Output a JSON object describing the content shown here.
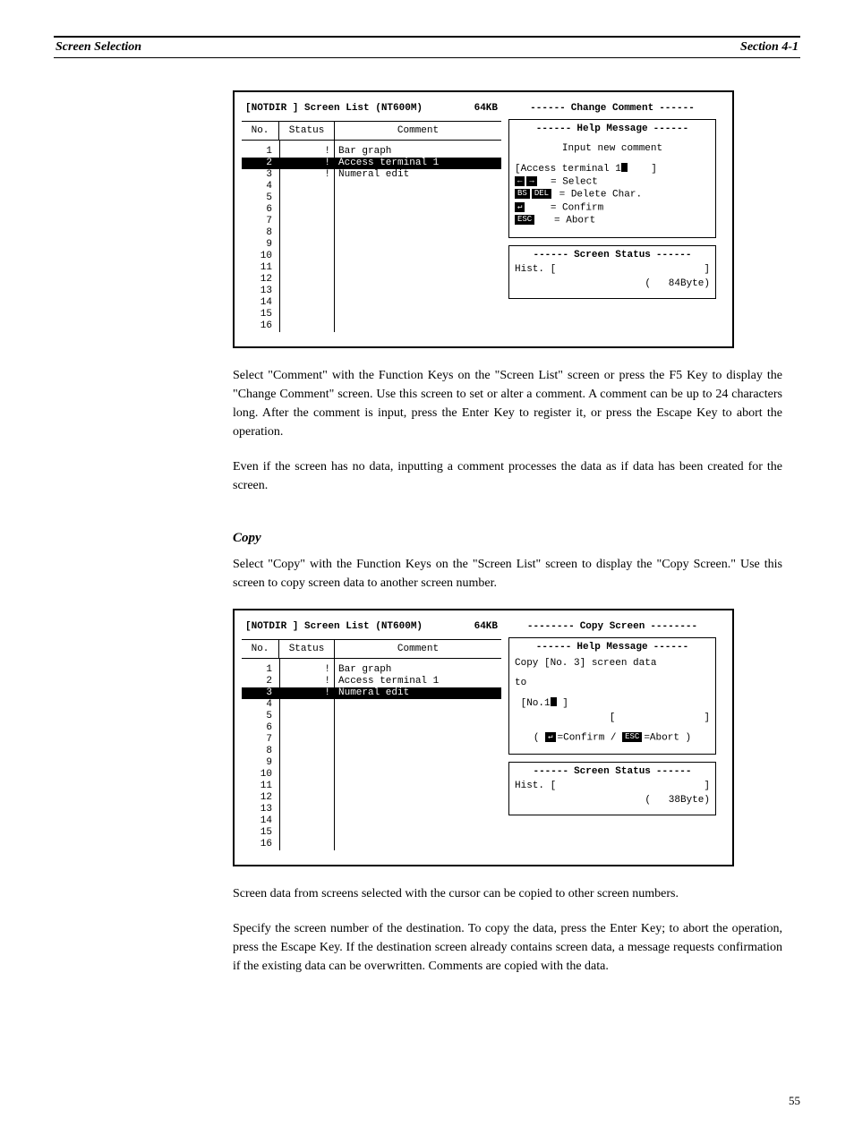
{
  "header": {
    "left": "Screen Selection",
    "right": "Section 4-1"
  },
  "fig1": {
    "title_left": "[NOTDIR  ]  Screen List (NT600M)",
    "title_right": "64KB",
    "cols": {
      "no": "No.",
      "status": "Status",
      "comment": "Comment"
    },
    "rows": [
      {
        "no": "1",
        "status": "!",
        "comment": "Bar graph",
        "sel": false
      },
      {
        "no": "2",
        "status": "!",
        "comment": "Access terminal 1",
        "sel": true
      },
      {
        "no": "3",
        "status": "!",
        "comment": "Numeral edit",
        "sel": false
      },
      {
        "no": "4",
        "status": "",
        "comment": "",
        "sel": false
      },
      {
        "no": "5",
        "status": "",
        "comment": "",
        "sel": false
      },
      {
        "no": "6",
        "status": "",
        "comment": "",
        "sel": false
      },
      {
        "no": "7",
        "status": "",
        "comment": "",
        "sel": false
      },
      {
        "no": "8",
        "status": "",
        "comment": "",
        "sel": false
      },
      {
        "no": "9",
        "status": "",
        "comment": "",
        "sel": false
      },
      {
        "no": "10",
        "status": "",
        "comment": "",
        "sel": false
      },
      {
        "no": "11",
        "status": "",
        "comment": "",
        "sel": false
      },
      {
        "no": "12",
        "status": "",
        "comment": "",
        "sel": false
      },
      {
        "no": "13",
        "status": "",
        "comment": "",
        "sel": false
      },
      {
        "no": "14",
        "status": "",
        "comment": "",
        "sel": false
      },
      {
        "no": "15",
        "status": "",
        "comment": "",
        "sel": false
      },
      {
        "no": "16",
        "status": "",
        "comment": "",
        "sel": false
      }
    ],
    "panel_title": "Change Comment",
    "help_title": "Help Message",
    "help": {
      "l1": "Input new comment",
      "input": "[Access terminal 1",
      "close": "]",
      "k_select": "= Select",
      "k_del": "= Delete Char.",
      "k_conf": "= Confirm",
      "k_abort": "= Abort",
      "keys": {
        "left": "←",
        "right": "→",
        "bs": "BS",
        "del": "DEL",
        "enter": "↵",
        "esc": "ESC"
      }
    },
    "status_title": "Screen Status",
    "hist": "Hist. [",
    "hist_close": "]",
    "bytes_open": "(",
    "bytes": "84Byte)"
  },
  "para1": "Select \"Comment\" with the Function Keys on the \"Screen List\" screen or press the F5 Key to display the \"Change Comment\" screen. Use this screen to set or alter a comment. A comment can be up to 24 characters long. After the comment is input, press the Enter Key to register it, or press the Escape Key to abort the operation.",
  "para2": "Even if the screen has no data, inputting a comment processes the data as if data has been created for the screen.",
  "section_title": "Copy",
  "section_body": "Select \"Copy\" with the Function Keys on the \"Screen List\" screen to display the \"Copy Screen.\" Use this screen to copy screen data to another screen number.",
  "fig2": {
    "title_left": "[NOTDIR  ]  Screen List (NT600M)",
    "title_right": "64KB",
    "cols": {
      "no": "No.",
      "status": "Status",
      "comment": "Comment"
    },
    "rows": [
      {
        "no": "1",
        "status": "!",
        "comment": "Bar graph",
        "sel": false
      },
      {
        "no": "2",
        "status": "!",
        "comment": "Access terminal 1",
        "sel": false
      },
      {
        "no": "3",
        "status": "!",
        "comment": "Numeral edit",
        "sel": true
      },
      {
        "no": "4",
        "status": "",
        "comment": "",
        "sel": false
      },
      {
        "no": "5",
        "status": "",
        "comment": "",
        "sel": false
      },
      {
        "no": "6",
        "status": "",
        "comment": "",
        "sel": false
      },
      {
        "no": "7",
        "status": "",
        "comment": "",
        "sel": false
      },
      {
        "no": "8",
        "status": "",
        "comment": "",
        "sel": false
      },
      {
        "no": "9",
        "status": "",
        "comment": "",
        "sel": false
      },
      {
        "no": "10",
        "status": "",
        "comment": "",
        "sel": false
      },
      {
        "no": "11",
        "status": "",
        "comment": "",
        "sel": false
      },
      {
        "no": "12",
        "status": "",
        "comment": "",
        "sel": false
      },
      {
        "no": "13",
        "status": "",
        "comment": "",
        "sel": false
      },
      {
        "no": "14",
        "status": "",
        "comment": "",
        "sel": false
      },
      {
        "no": "15",
        "status": "",
        "comment": "",
        "sel": false
      },
      {
        "no": "16",
        "status": "",
        "comment": "",
        "sel": false
      }
    ],
    "panel_title": "Copy Screen",
    "help_title": "Help Message",
    "help": {
      "l1": "Copy [No.   3] screen data",
      "l2": "to",
      "l3a": "[No.1",
      "l3b": "  ]",
      "l4a": "[",
      "l4b": "]",
      "conf_open": "(",
      "conf_a": "=Confirm /",
      "conf_b": "=Abort )",
      "enter": "↵",
      "esc": "ESC"
    },
    "status_title": "Screen Status",
    "hist": "Hist. [",
    "hist_close": "]",
    "bytes_open": "(",
    "bytes": "38Byte)"
  },
  "para3": "Screen data from screens selected with the cursor can be copied to other screen numbers.",
  "para4": "Specify the screen number of the destination. To copy the data, press the Enter Key; to abort the operation, press the Escape Key. If the destination screen already contains screen data, a message requests confirmation if the existing data can be overwritten. Comments are copied with the data.",
  "page": "55"
}
